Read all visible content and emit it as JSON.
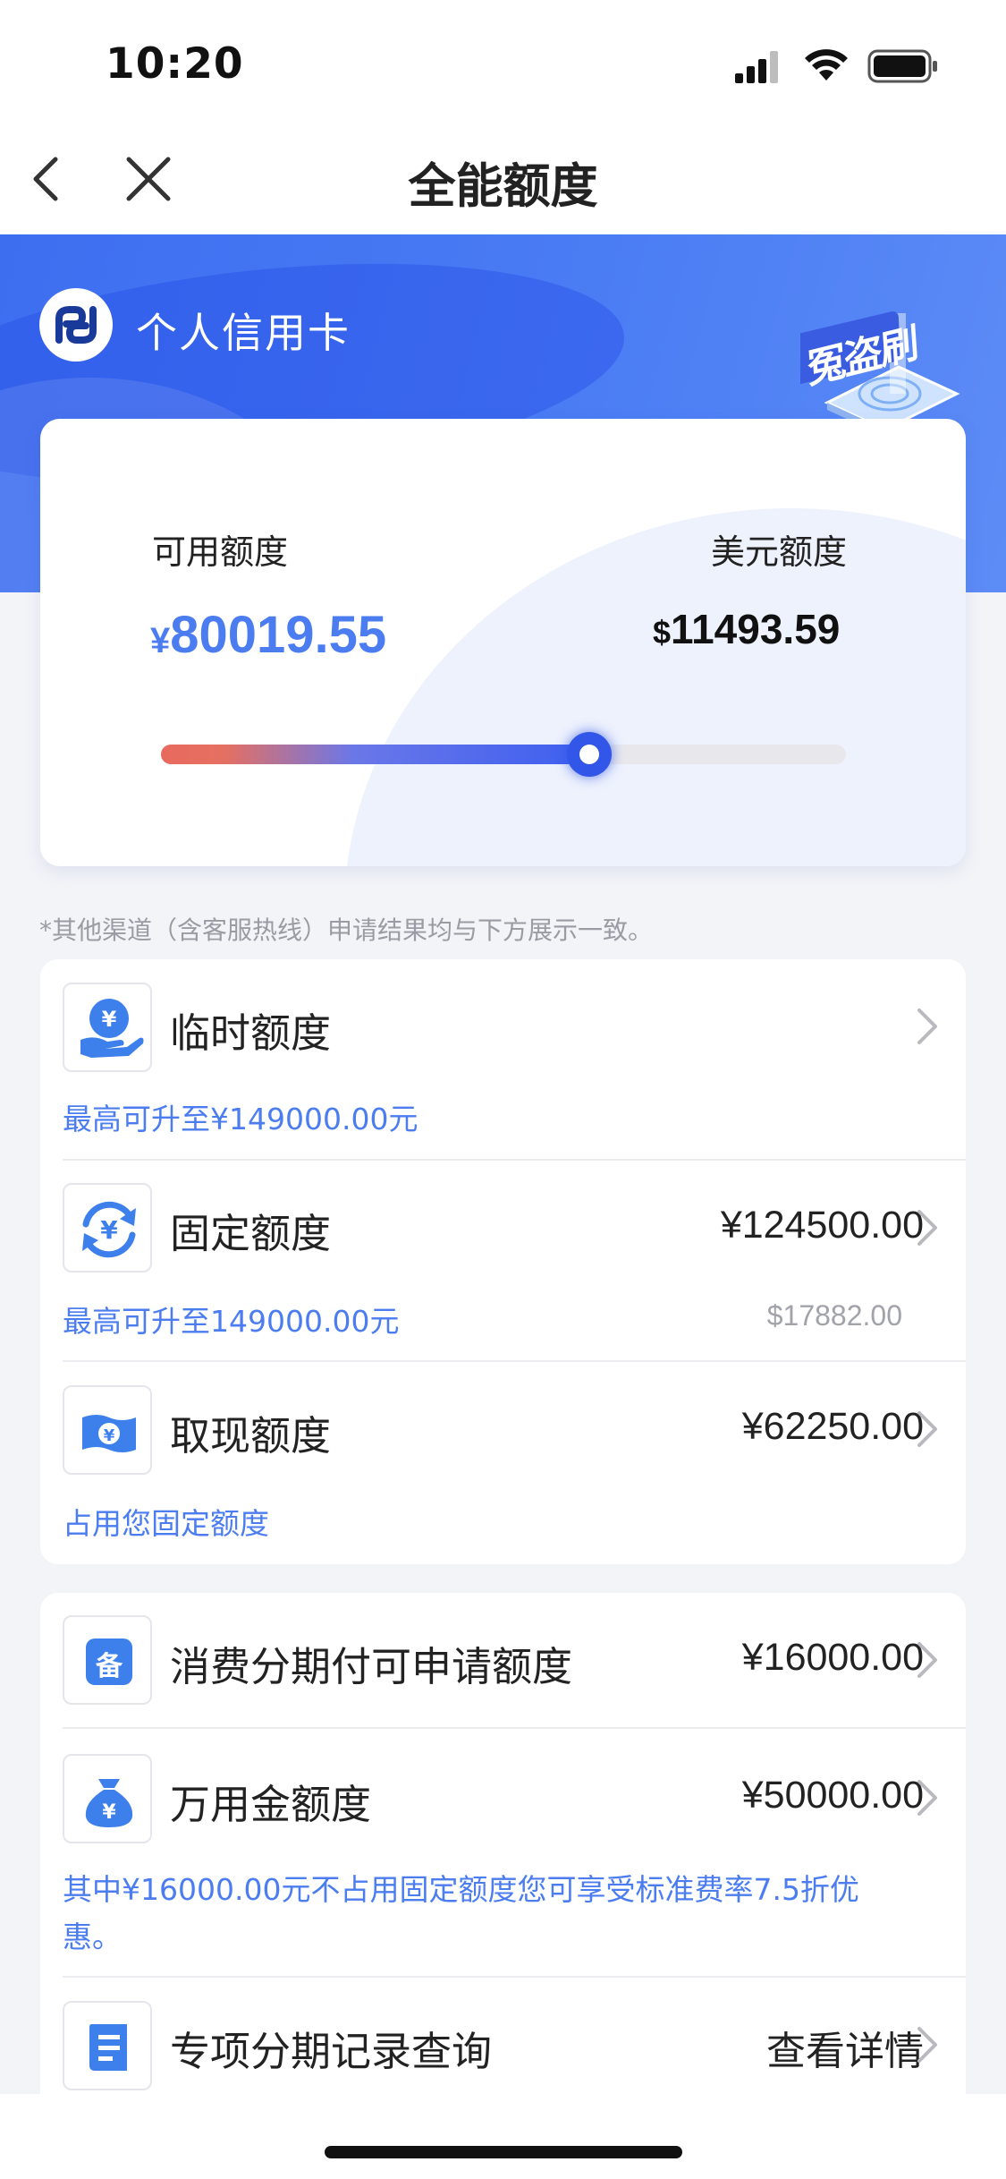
{
  "status_bar": {
    "time": "10:20"
  },
  "nav": {
    "title": "全能额度"
  },
  "header": {
    "brand": "个人信用卡",
    "badge_text": "冤盗刷"
  },
  "summary": {
    "available_label": "可用额度",
    "available_currency": "¥",
    "available_amount": "80019.55",
    "usd_label": "美元额度",
    "usd_currency": "$",
    "usd_amount": "11493.59",
    "usage_fraction": 0.625
  },
  "note": "*其他渠道（含客服热线）申请结果均与下方展示一致。",
  "rows": [
    {
      "title": "临时额度",
      "value": "",
      "sub": "最高可升至¥149000.00元",
      "sub_right": ""
    },
    {
      "title": "固定额度",
      "value": "¥124500.00",
      "sub": "最高可升至149000.00元",
      "sub_right": "$17882.00"
    },
    {
      "title": "取现额度",
      "value": "¥62250.00",
      "sub": "占用您固定额度",
      "sub_right": ""
    }
  ],
  "rows2": [
    {
      "title": "消费分期付可申请额度",
      "value": "¥16000.00",
      "icon_char": "备"
    },
    {
      "title": "万用金额度",
      "value": "¥50000.00",
      "sub_line1": "其中¥16000.00元不占用固定额度您可享受标准费率7.5折优",
      "sub_line2": "惠。"
    },
    {
      "title": "专项分期记录查询",
      "value": "查看详情"
    }
  ],
  "colors": {
    "accent": "#4b7df0",
    "header_blue": "#3d6ef0",
    "slider_red": "#e86a5e"
  },
  "icons": [
    "back-icon",
    "close-icon",
    "signal-icon",
    "wifi-icon",
    "battery-icon",
    "bank-logo-icon",
    "anti-fraud-badge-icon",
    "hand-yen-icon",
    "yen-refresh-icon",
    "banknote-icon",
    "file-icon",
    "money-bag-icon",
    "document-list-icon",
    "chevron-right-icon"
  ]
}
